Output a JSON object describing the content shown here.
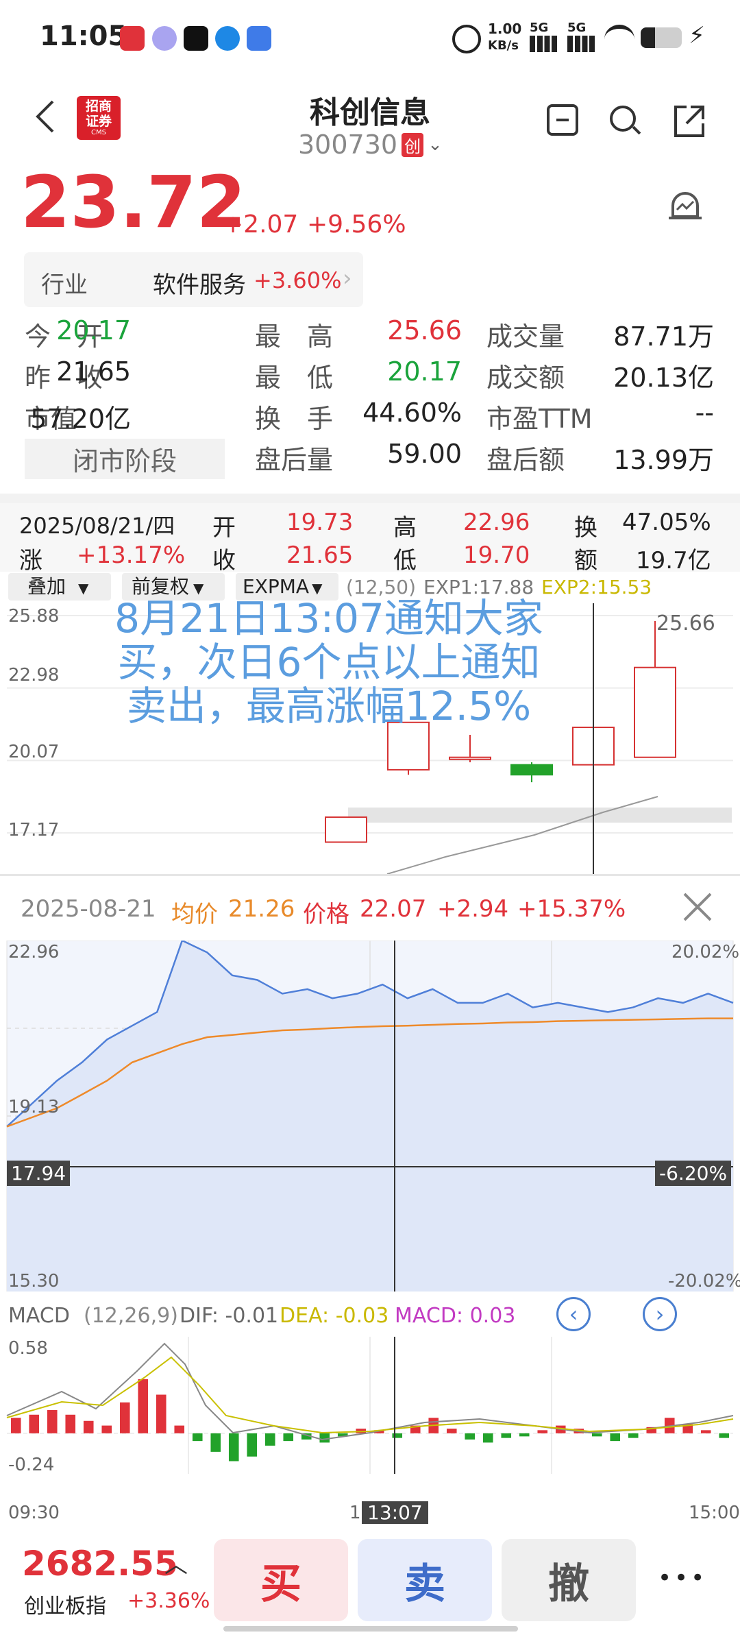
{
  "status_bar": {
    "time": "11:05",
    "net_speed": "1.00",
    "net_unit": "KB/s",
    "sig1": "5G",
    "sig2": "5G"
  },
  "header": {
    "broker": "招商\n证券",
    "broker_sub": "CMS",
    "title": "科创信息",
    "code": "300730",
    "board": "创"
  },
  "price": {
    "last": "23.72",
    "change": "+2.07",
    "pct": "+9.56%"
  },
  "industry": {
    "label": "行业",
    "name": "软件服务",
    "pct": "+3.60%"
  },
  "stats": [
    {
      "label": "今　开",
      "value": "20.17",
      "color": "#1aa33b"
    },
    {
      "label": "最　高",
      "value": "25.66",
      "color": "#e0323a"
    },
    {
      "label": "成交量",
      "value": "87.71万",
      "color": "#222222"
    },
    {
      "label": "昨　收",
      "value": "21.65",
      "color": "#222222"
    },
    {
      "label": "最　低",
      "value": "20.17",
      "color": "#1aa33b"
    },
    {
      "label": "成交额",
      "value": "20.13亿",
      "color": "#222222"
    },
    {
      "label": "市值",
      "value": "57.20亿",
      "color": "#222222"
    },
    {
      "label": "换　手",
      "value": "44.60%",
      "color": "#222222"
    },
    {
      "label": "市盈TTM",
      "value": "--",
      "color": "#222222"
    },
    {
      "label": "闭市阶段",
      "value": "",
      "color": "#222222"
    },
    {
      "label": "盘后量",
      "value": "59.00",
      "color": "#222222"
    },
    {
      "label": "盘后额",
      "value": "13.99万",
      "color": "#222222"
    }
  ],
  "kline_info": {
    "date": "2025/08/21/四",
    "open_l": "开",
    "open": "19.73",
    "high_l": "高",
    "high": "22.96",
    "turn_l": "换",
    "turn": "47.05%",
    "chg_l": "涨",
    "chg": "+13.17%",
    "close_l": "收",
    "close": "21.65",
    "low_l": "低",
    "low": "19.70",
    "amt_l": "额",
    "amt": "19.7亿"
  },
  "kline_toolbar": {
    "overlay": "叠加",
    "adjust": "前复权",
    "indicator": "EXPMA",
    "params": "(12,50)",
    "exp1": "EXP1:17.88",
    "exp2": "EXP2:15.53"
  },
  "kline_axis": {
    "y1": "25.88",
    "y2": "22.98",
    "y3": "20.07",
    "y4": "17.17",
    "high_mark": "25.66"
  },
  "annotation": {
    "line1": "8月21日13:07通知大家",
    "line2": "买，次日6个点以上通知",
    "line3": "卖出，最高涨幅12.5%"
  },
  "intraday_header": {
    "date": "2025-08-21",
    "avg_label": "均价",
    "avg": "21.26",
    "price_label": "价格",
    "price": "22.07",
    "chg": "+2.94",
    "pct": "+15.37%"
  },
  "intraday_axis": {
    "top": "22.96",
    "top_pct": "20.02%",
    "mid": "19.13",
    "cross_price": "17.94",
    "cross_pct": "-6.20%",
    "bottom": "15.30",
    "bottom_pct": "-20.02%"
  },
  "macd_header": {
    "name": "MACD",
    "params": "(12,26,9)",
    "dif": "DIF: -0.01",
    "dea": "DEA: -0.03",
    "macd": "MACD: 0.03"
  },
  "macd_axis": {
    "top": "0.58",
    "bottom": "-0.24",
    "start": "09:30",
    "mid": "11",
    "cross_time": "13:07",
    "end": "15:00"
  },
  "footer": {
    "index_value": "2682.55",
    "index_name": "创业板指",
    "index_pct": "+3.36%",
    "buy": "买",
    "sell": "卖",
    "cancel": "撤",
    "more": "•••"
  },
  "chart_data": [
    {
      "type": "candlestick",
      "title": "",
      "ylim": [
        17.17,
        25.88
      ],
      "candles": [
        {
          "open": 16.8,
          "close": 17.8,
          "high": 17.8,
          "low": 16.8
        },
        {
          "open": 19.7,
          "close": 21.6,
          "high": 21.6,
          "low": 19.5
        },
        {
          "open": 20.2,
          "close": 20.2,
          "high": 21.1,
          "low": 20.0
        },
        {
          "open": 19.9,
          "close": 19.5,
          "high": 20.0,
          "low": 19.2
        },
        {
          "open": 19.9,
          "close": 21.4,
          "high": 21.4,
          "low": 19.9
        },
        {
          "open": 20.2,
          "close": 23.8,
          "high": 25.66,
          "low": 20.2
        }
      ]
    },
    {
      "type": "line",
      "title": "",
      "ylim": [
        15.3,
        22.96
      ],
      "series": [
        {
          "values": [
            18.9,
            19.4,
            19.9,
            20.3,
            20.8,
            21.1,
            21.4,
            22.96,
            22.7,
            22.2,
            22.1,
            21.8,
            21.9,
            21.7,
            21.8,
            22.0,
            21.7,
            21.9,
            21.6,
            21.6,
            21.8,
            21.5,
            21.6,
            21.5,
            21.4,
            21.5,
            21.7,
            21.6,
            21.8,
            21.6
          ]
        },
        {
          "values": [
            18.9,
            19.1,
            19.3,
            19.6,
            19.9,
            20.3,
            20.5,
            20.7,
            20.85,
            20.9,
            20.95,
            21.0,
            21.02,
            21.05,
            21.07,
            21.09,
            21.1,
            21.12,
            21.14,
            21.15,
            21.17,
            21.18,
            21.2,
            21.21,
            21.22,
            21.23,
            21.24,
            21.25,
            21.26,
            21.26
          ]
        }
      ]
    },
    {
      "type": "bar",
      "title": "",
      "ylim": [
        -0.24,
        0.58
      ],
      "values": [
        0.1,
        0.12,
        0.15,
        0.12,
        0.08,
        0.05,
        0.2,
        0.35,
        0.25,
        0.05,
        -0.05,
        -0.12,
        -0.18,
        -0.15,
        -0.08,
        -0.05,
        -0.04,
        -0.06,
        -0.02,
        0.03,
        0.02,
        -0.03,
        0.05,
        0.1,
        0.03,
        -0.04,
        -0.06,
        -0.03,
        -0.02,
        0.02,
        0.05,
        0.03,
        -0.02,
        -0.05,
        -0.03,
        0.04,
        0.1,
        0.06,
        0.02,
        -0.03
      ]
    }
  ]
}
